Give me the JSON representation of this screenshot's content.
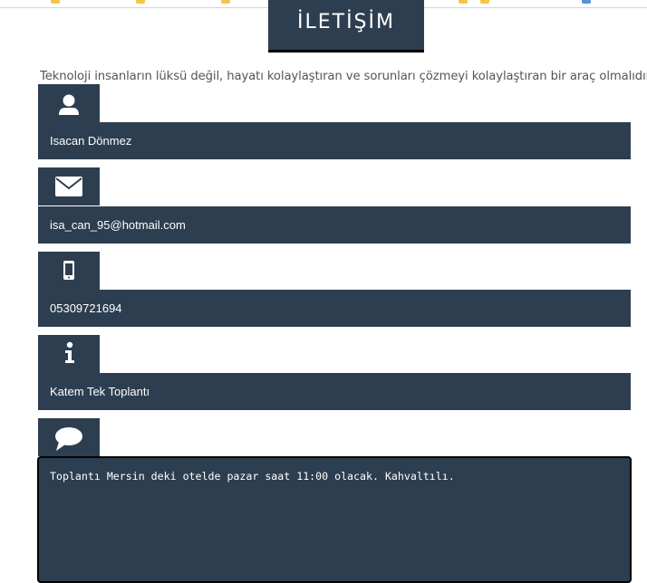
{
  "bookmarks_bar": {
    "items": [
      {
        "icon": "folder-icon"
      },
      {
        "icon": "folder-icon"
      },
      {
        "icon": "folder-icon"
      },
      {
        "icon": "folder-icon"
      },
      {
        "icon": "folder-icon"
      },
      {
        "icon": "folder-icon"
      },
      {
        "icon": "folder-icon"
      },
      {
        "icon": "page-icon"
      }
    ]
  },
  "header": {
    "title": "İLETİŞİM",
    "tagline": "Teknoloji insanların lüksü değil, hayatı kolaylaştıran ve sorunları çözmeyi kolaylaştıran bir araç olmalıdır."
  },
  "form": {
    "name": {
      "icon": "user-icon",
      "value": "Isacan Dönmez"
    },
    "email": {
      "icon": "envelope-icon",
      "value": "isa_can_95@hotmail.com"
    },
    "phone": {
      "icon": "mobile-phone-icon",
      "value": "05309721694"
    },
    "subject": {
      "icon": "info-icon",
      "value": "Katem Tek Toplantı"
    },
    "message": {
      "icon": "speech-bubble-icon",
      "value": "Toplantı Mersin deki otelde pazar saat 11:00 olacak. Kahvaltılı."
    }
  },
  "colors": {
    "panel": "#2d3e50",
    "text_on_panel": "#ffffff",
    "tagline": "#555555",
    "title_underline": "#000000"
  }
}
